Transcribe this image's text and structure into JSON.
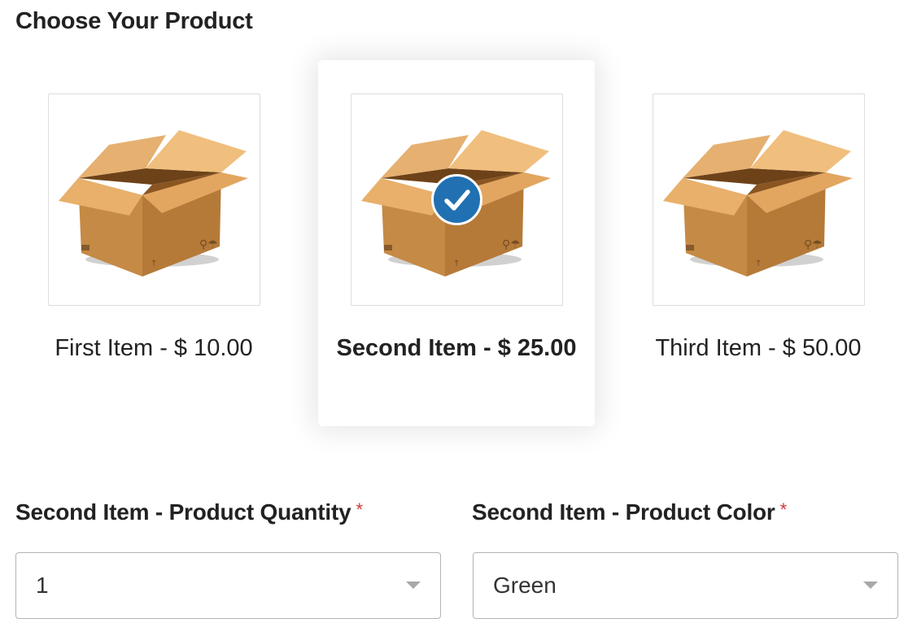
{
  "section_title": "Choose Your Product",
  "products": [
    {
      "label": "First Item - $ 10.00",
      "selected": false,
      "image_icon": "cardboard-box-icon"
    },
    {
      "label": "Second Item - $ 25.00",
      "selected": true,
      "image_icon": "cardboard-box-icon"
    },
    {
      "label": "Third Item - $ 50.00",
      "selected": false,
      "image_icon": "cardboard-box-icon"
    }
  ],
  "fields": {
    "quantity": {
      "label": "Second Item - Product Quantity",
      "required_mark": "*",
      "value": "1"
    },
    "color": {
      "label": "Second Item - Product Color",
      "required_mark": "*",
      "value": "Green"
    }
  },
  "colors": {
    "check_badge": "#2170b2",
    "required": "#d63637",
    "box_face": "#c8904a"
  }
}
